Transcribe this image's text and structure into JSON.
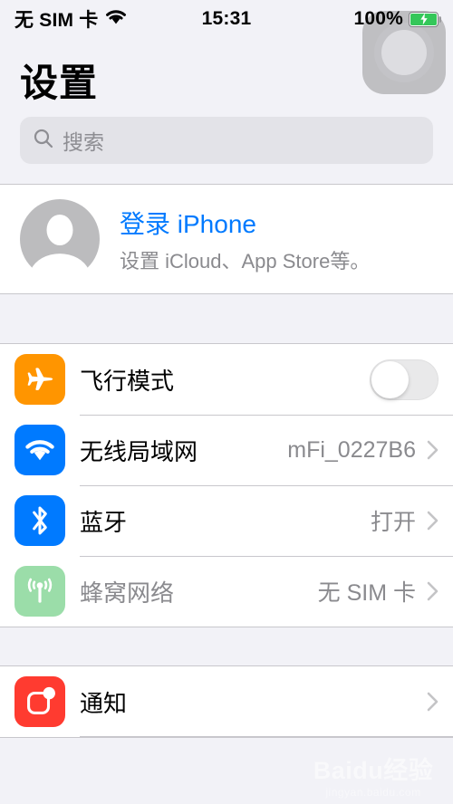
{
  "status_bar": {
    "carrier": "无 SIM 卡",
    "wifi_icon": "wifi-icon",
    "time": "15:31",
    "battery_percent": "100%",
    "battery_icon": "battery-charging-icon"
  },
  "assistive_touch": {
    "name": "assistive-touch-button"
  },
  "header": {
    "title": "设置"
  },
  "search": {
    "placeholder": "搜索",
    "icon": "search-icon"
  },
  "account": {
    "avatar_icon": "avatar-placeholder-icon",
    "title": "登录 iPhone",
    "subtitle": "设置 iCloud、App Store等。",
    "accent_color": "#007AFF"
  },
  "connectivity": {
    "rows": [
      {
        "label": "飞行模式",
        "icon": "airplane-icon",
        "icon_color": "#FF9500",
        "control": "toggle",
        "toggle_on": false,
        "value": "",
        "disabled": false
      },
      {
        "label": "无线局域网",
        "icon": "wifi-icon",
        "icon_color": "#007AFF",
        "control": "chevron",
        "value": "mFi_0227B6",
        "disabled": false
      },
      {
        "label": "蓝牙",
        "icon": "bluetooth-icon",
        "icon_color": "#007AFF",
        "control": "chevron",
        "value": "打开",
        "disabled": false
      },
      {
        "label": "蜂窝网络",
        "icon": "cellular-icon",
        "icon_color": "#9BDDA9",
        "control": "chevron",
        "value": "无 SIM 卡",
        "disabled": true
      }
    ]
  },
  "notifications_group": {
    "rows": [
      {
        "label": "通知",
        "icon": "notifications-icon",
        "icon_color": "#FF3B30",
        "control": "chevron",
        "value": "",
        "disabled": false
      }
    ]
  },
  "watermark": {
    "main": "Baidu经验",
    "sub": "jingyan.baidu.com"
  }
}
